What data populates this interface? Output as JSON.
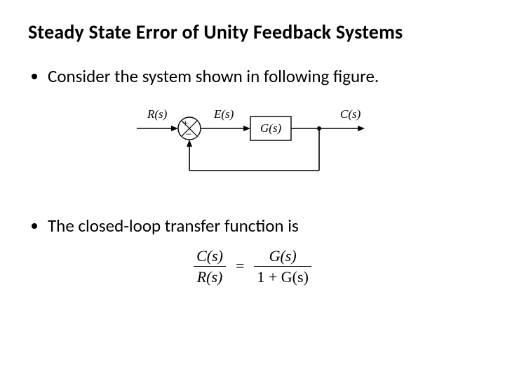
{
  "title": "Steady State Error of Unity Feedback Systems",
  "bullet1": "Consider the system shown in following figure.",
  "bullet2": "The closed-loop transfer function is",
  "diagram": {
    "input_label": "R(s)",
    "error_label": "E(s)",
    "block_label": "G(s)",
    "output_label": "C(s)",
    "sum_plus": "+",
    "sum_minus": "−"
  },
  "equation": {
    "lhs_num": "C(s)",
    "lhs_den": "R(s)",
    "eq": "=",
    "rhs_num": "G(s)",
    "rhs_den": "1 + G(s)"
  }
}
